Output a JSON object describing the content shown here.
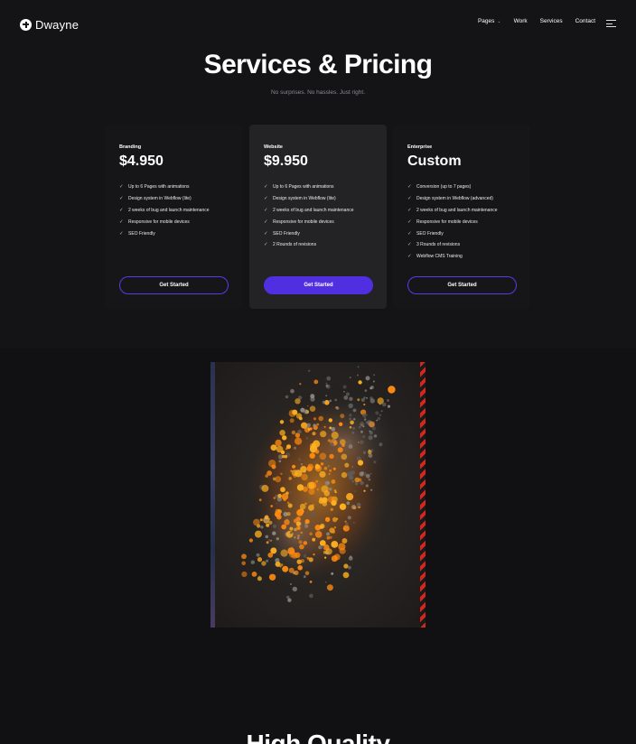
{
  "brand": {
    "name": "Dwayne"
  },
  "nav": {
    "items": [
      "Pages",
      "Work",
      "Services",
      "Contact"
    ]
  },
  "hero": {
    "title": "Services & Pricing",
    "subtitle": "No surprises. No hassles. Just right."
  },
  "plans": [
    {
      "tier": "Branding",
      "price": "$4.950",
      "features": [
        "Up to 6 Pages with animations",
        "Design system in Webflow (lite)",
        "2 weeks of bug and launch maintenance",
        "Responsive for mobile devices",
        "SEO Friendly"
      ],
      "cta": "Get Started"
    },
    {
      "tier": "Website",
      "price": "$9.950",
      "features": [
        "Up to 6 Pages with animations",
        "Design system in Webflow (lite)",
        "2 weeks of bug and launch maintenance",
        "Responsive for mobile devices",
        "SEO Friendly",
        "2 Rounds of revisions"
      ],
      "cta": "Get Started"
    },
    {
      "tier": "Enterprise",
      "price": "Custom",
      "features": [
        "Conversion (up to 7 pages)",
        "Design system in Webflow (advanced)",
        "2 weeks of bug and launch maintenance",
        "Responsive for mobile devices",
        "SEO Friendly",
        "3 Rounds of revisions",
        "Webflow CMS Training"
      ],
      "cta": "Get Started"
    }
  ],
  "section2": {
    "title": "High Quality"
  },
  "colors": {
    "accent": "#4f2fe0",
    "background": "#111114",
    "card": "#232326"
  }
}
